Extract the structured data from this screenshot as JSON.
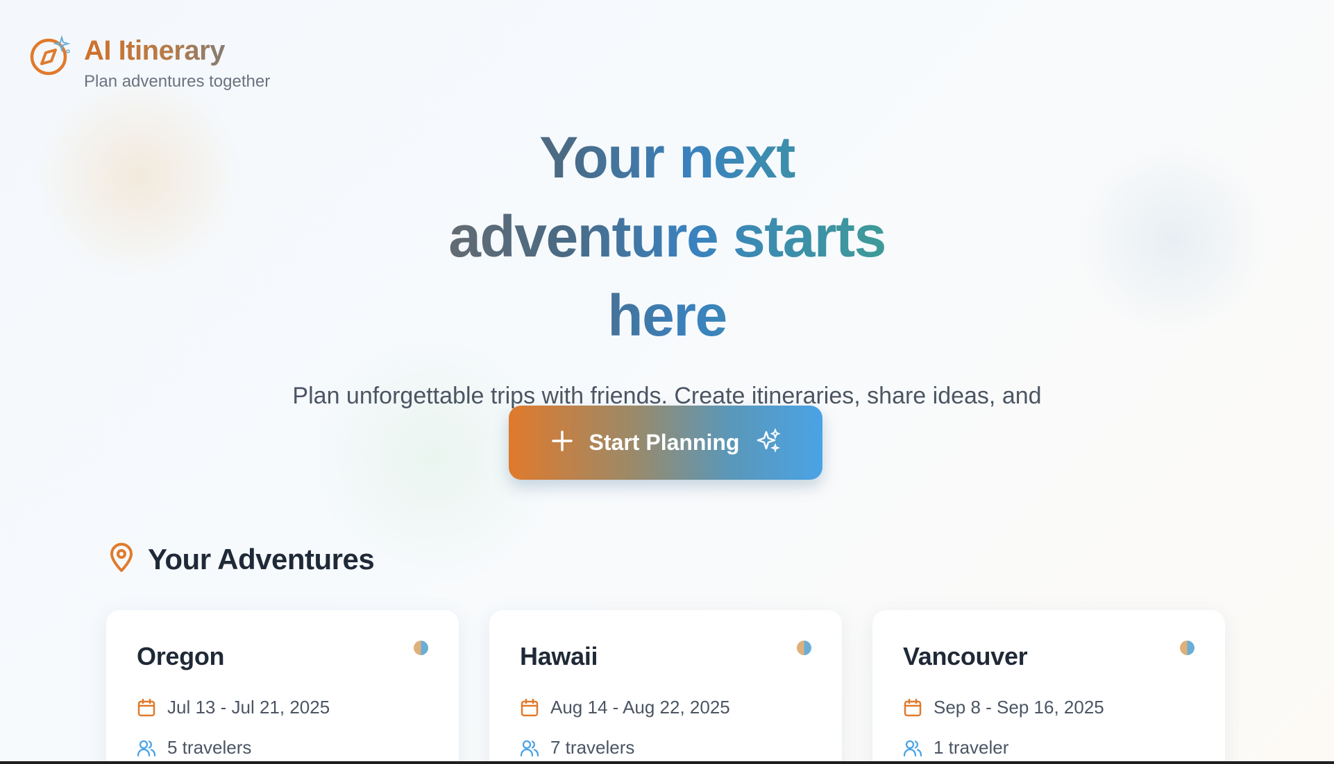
{
  "brand": {
    "title": "AI Itinerary",
    "subtitle": "Plan adventures together",
    "icon": "compass-sparkle-icon"
  },
  "hero": {
    "title": "Your next adventure starts here",
    "description": "Plan unforgettable trips with friends. Create itineraries, share ideas, and make memories together.",
    "cta_label": "Start Planning"
  },
  "section": {
    "title": "Your Adventures",
    "icon": "map-pin-icon"
  },
  "trips": [
    {
      "name": "Oregon",
      "dates": "Jul 13 - Jul 21, 2025",
      "travelers": "5 travelers"
    },
    {
      "name": "Hawaii",
      "dates": "Aug 14 - Aug 22, 2025",
      "travelers": "7 travelers"
    },
    {
      "name": "Vancouver",
      "dates": "Sep 8 - Sep 16, 2025",
      "travelers": "1 traveler"
    }
  ],
  "colors": {
    "accent_orange": "#e07a2c",
    "accent_blue": "#4aa3e6",
    "text_dark": "#1f2937",
    "text_muted": "#4b5563"
  }
}
